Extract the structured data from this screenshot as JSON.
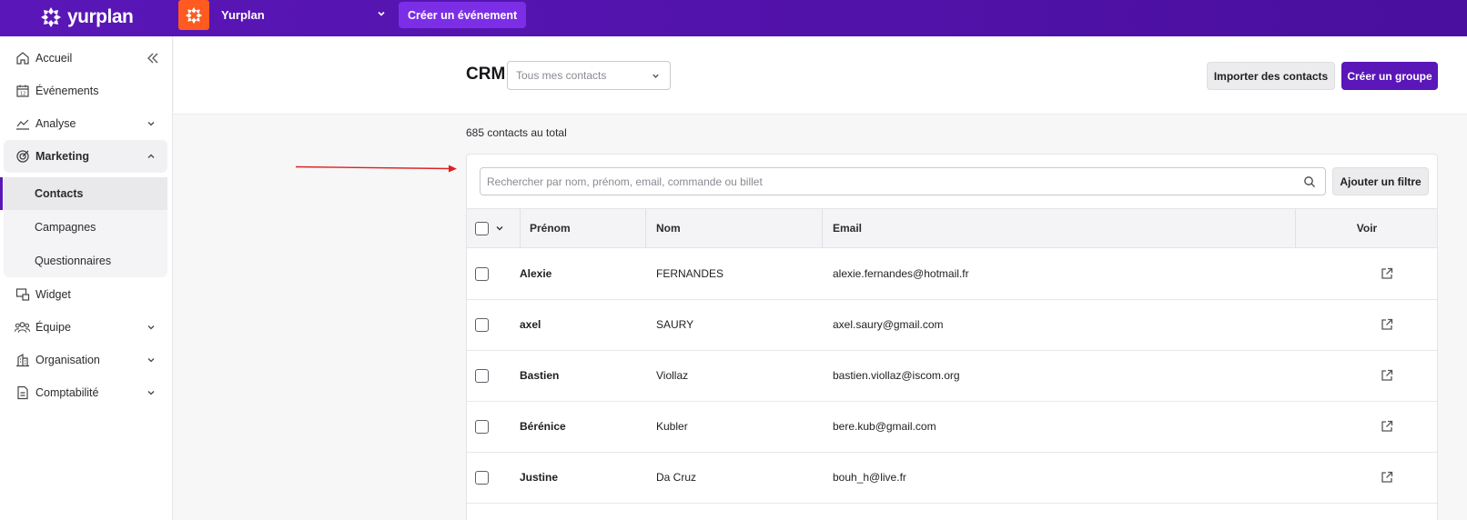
{
  "topbar": {
    "logo_text": "yurplan",
    "org_name": "Yurplan",
    "create_event_label": "Créer un événement",
    "brand_color": "#5a16b8",
    "org_color": "#ff5a1f"
  },
  "sidebar": {
    "items": [
      {
        "label": "Accueil",
        "icon": "home-icon"
      },
      {
        "label": "Événements",
        "icon": "calendar-icon"
      },
      {
        "label": "Analyse",
        "icon": "chart-icon"
      },
      {
        "label": "Marketing",
        "icon": "target-icon"
      },
      {
        "label": "Widget",
        "icon": "widget-icon"
      },
      {
        "label": "Équipe",
        "icon": "team-icon"
      },
      {
        "label": "Organisation",
        "icon": "building-icon"
      },
      {
        "label": "Comptabilité",
        "icon": "document-icon"
      }
    ],
    "marketing_sub": [
      {
        "label": "Contacts",
        "active": true
      },
      {
        "label": "Campagnes"
      },
      {
        "label": "Questionnaires"
      }
    ]
  },
  "header": {
    "title": "CRM",
    "select_value": "Tous mes contacts",
    "import_label": "Importer des contacts",
    "create_group_label": "Créer un groupe"
  },
  "summary": {
    "total_text": "685 contacts au total"
  },
  "search": {
    "placeholder": "Rechercher par nom, prénom, email, commande ou billet",
    "add_filter_label": "Ajouter un filtre"
  },
  "table": {
    "columns": {
      "first_name": "Prénom",
      "last_name": "Nom",
      "email": "Email",
      "view": "Voir"
    },
    "rows": [
      {
        "first_name": "Alexie",
        "last_name": "FERNANDES",
        "email": "alexie.fernandes@hotmail.fr"
      },
      {
        "first_name": "axel",
        "last_name": "SAURY",
        "email": "axel.saury@gmail.com"
      },
      {
        "first_name": "Bastien",
        "last_name": "Viollaz",
        "email": "bastien.viollaz@iscom.org"
      },
      {
        "first_name": "Bérénice",
        "last_name": "Kubler",
        "email": "bere.kub@gmail.com"
      },
      {
        "first_name": "Justine",
        "last_name": "Da Cruz",
        "email": "bouh_h@live.fr"
      }
    ]
  }
}
